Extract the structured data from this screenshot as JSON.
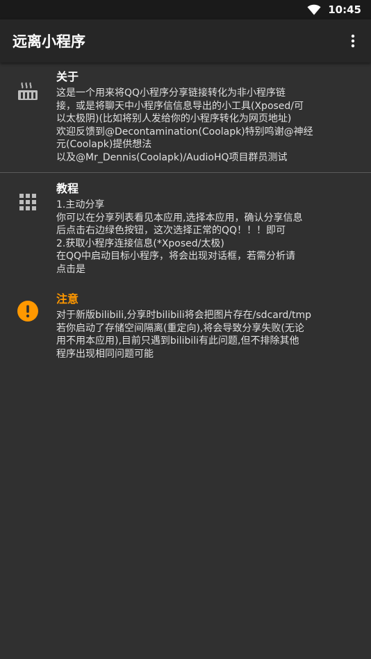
{
  "status_bar": {
    "time": "10:45"
  },
  "app_bar": {
    "title": "远离小程序"
  },
  "sections": [
    {
      "title": "关于",
      "text": "这是一个用来将QQ小程序分享链接转化为非小程序链\n接，或是将聊天中小程序信信息导出的小工具(Xposed/可\n以太极阴)(比如将别人发给你的小程序转化为网页地址)\n欢迎反馈到@Decontamination(Coolapk)特别鸣谢@神经\n元(Coolapk)提供想法\n以及@Mr_Dennis(Coolapk)/AudioHQ项目群员测试"
    },
    {
      "title": "教程",
      "text": "1.主动分享\n你可以在分享列表看见本应用,选择本应用，确认分享信息\n后点击右边绿色按钮，这次选择正常的QQ！！！即可\n 2.获取小程序连接信息(*Xposed/太极)\n在QQ中启动目标小程序，将会出现对话框，若需分析请\n点击是"
    },
    {
      "title": "注意",
      "text": "对于新版bilibili,分享时bilibili将会把图片存在/sdcard/tmp\n若你启动了存储空间隔离(重定向),将会导致分享失败(无论\n用不用本应用),目前只遇到bilibili有此问题,但不排除其他\n程序出现相同问题可能"
    }
  ],
  "colors": {
    "warning": "#ff9800",
    "background": "#303030",
    "app_bar": "#262626"
  }
}
